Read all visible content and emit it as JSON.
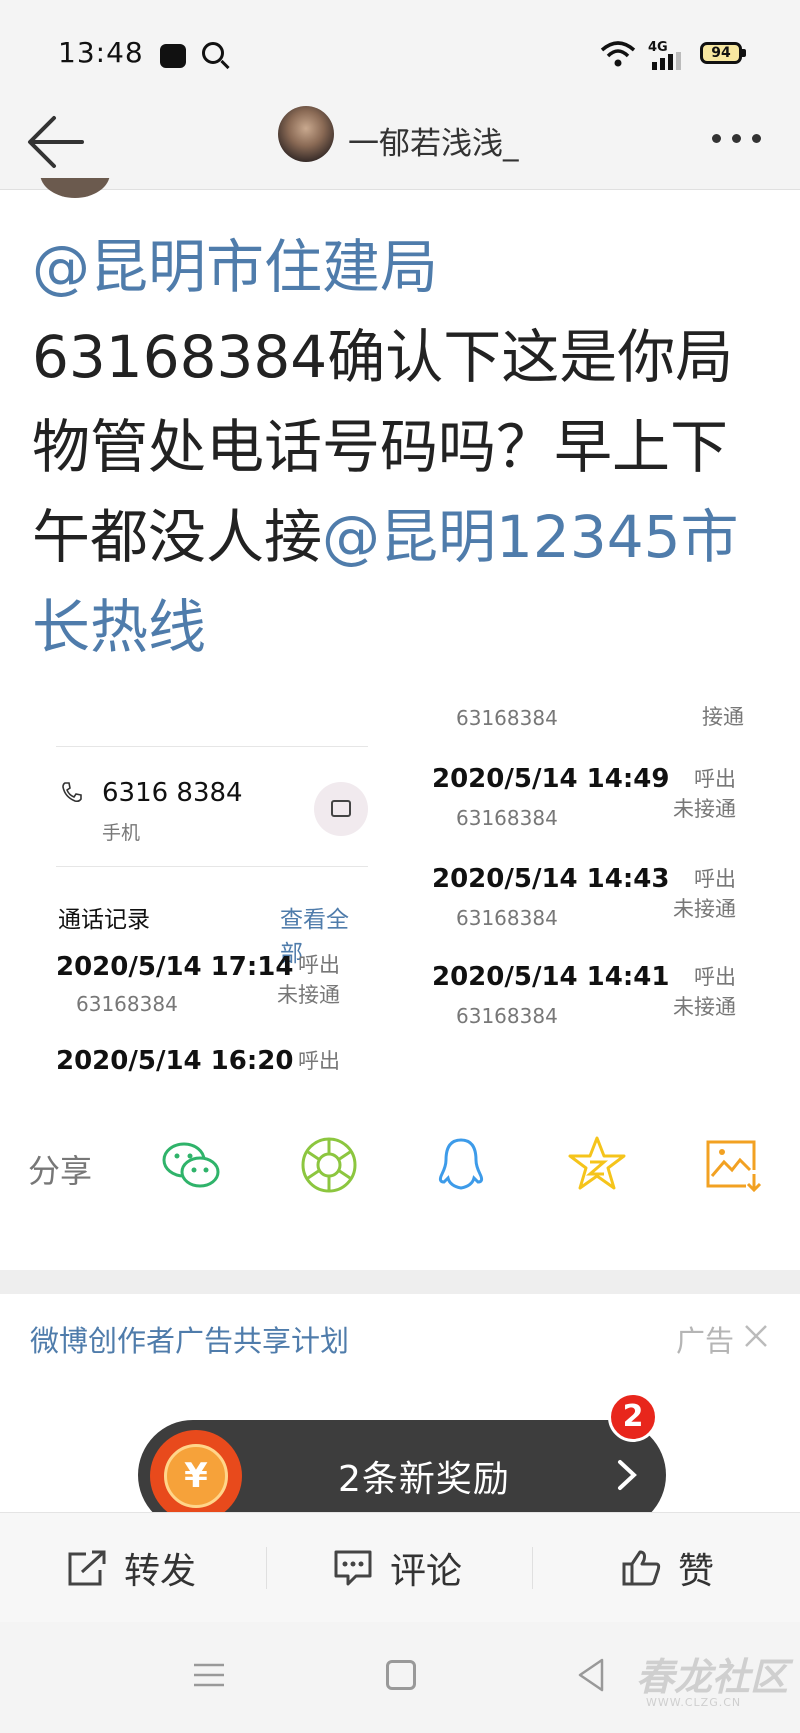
{
  "status_bar": {
    "time": "13:48",
    "network": "4G",
    "battery": "94"
  },
  "nav": {
    "username": "一郁若浅浅_"
  },
  "post": {
    "mention_1": "@昆明市住建局",
    "body": "63168384确认下这是你局物管处电话号码吗？早上下午都没人接",
    "mention_2": "@昆明12345市长热线"
  },
  "screenshot_left": {
    "phone_number": "6316 8384",
    "phone_type": "手机",
    "calllog_title": "通话记录",
    "calllog_view_all": "查看全部",
    "calls": [
      {
        "date": "2020/5/14 17:14",
        "number": "63168384",
        "status": "呼出 未接通"
      },
      {
        "date": "2020/5/14 16:20",
        "number": "",
        "status": "呼出 未"
      }
    ]
  },
  "screenshot_right": {
    "top_number": "63168384",
    "top_status": "接通",
    "calls": [
      {
        "date": "2020/5/14 14:49",
        "number": "63168384",
        "status": "呼出 未接通"
      },
      {
        "date": "2020/5/14 14:43",
        "number": "63168384",
        "status": "呼出 未接通"
      },
      {
        "date": "2020/5/14 14:41",
        "number": "63168384",
        "status": "呼出 未接通"
      }
    ]
  },
  "share": {
    "label": "分享",
    "targets": [
      "wechat-icon",
      "moments-icon",
      "qq-icon",
      "qzone-icon",
      "save-image-icon"
    ],
    "colors": {
      "wechat": "#2fb36a",
      "moments": "#8cc63f",
      "qq": "#3d9be9",
      "qzone": "#f5c41b",
      "save": "#f2a122"
    }
  },
  "ad": {
    "title": "微博创作者广告共享计划",
    "label": "广告"
  },
  "reward": {
    "text": "2条新奖励",
    "badge_count": "2",
    "coin_symbol": "¥"
  },
  "actions": {
    "repost": "转发",
    "comment": "评论",
    "like": "赞"
  },
  "watermark": {
    "text": "春龙社区",
    "url": "WWW.CLZG.CN"
  }
}
